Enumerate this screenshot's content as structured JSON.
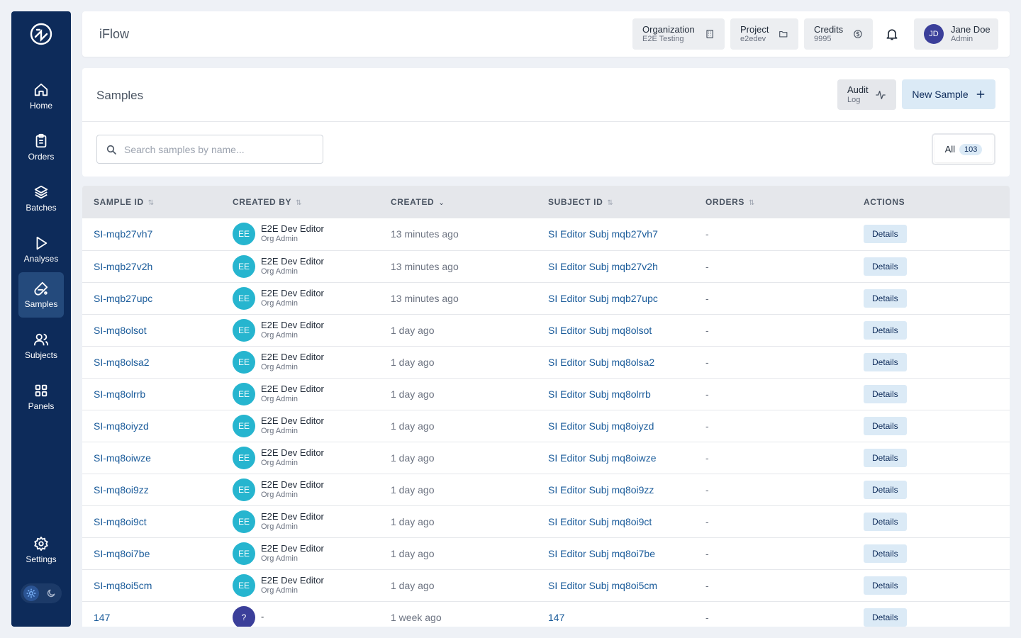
{
  "app": {
    "title": "iFlow"
  },
  "sidebar": {
    "items": [
      {
        "label": "Home",
        "icon": "home-icon"
      },
      {
        "label": "Orders",
        "icon": "clipboard-icon"
      },
      {
        "label": "Batches",
        "icon": "layers-icon"
      },
      {
        "label": "Analyses",
        "icon": "play-icon"
      },
      {
        "label": "Samples",
        "icon": "flask-icon",
        "active": true
      },
      {
        "label": "Subjects",
        "icon": "users-icon"
      },
      {
        "label": "Panels",
        "icon": "grid-icon"
      }
    ],
    "settings": {
      "label": "Settings",
      "icon": "gear-icon"
    },
    "theme": {
      "selected": "light"
    }
  },
  "header": {
    "organization": {
      "title": "Organization",
      "value": "E2E Testing"
    },
    "project": {
      "title": "Project",
      "value": "e2edev"
    },
    "credits": {
      "title": "Credits",
      "value": "9995"
    },
    "user": {
      "initials": "JD",
      "name": "Jane Doe",
      "role": "Admin"
    }
  },
  "samples": {
    "title": "Samples",
    "audit": {
      "title": "Audit",
      "sub": "Log"
    },
    "new_label": "New Sample",
    "search_placeholder": "Search samples by name...",
    "filter": {
      "label": "All",
      "count": "103"
    }
  },
  "table": {
    "columns": [
      "SAMPLE ID",
      "CREATED BY",
      "CREATED",
      "SUBJECT ID",
      "ORDERS",
      "ACTIONS"
    ],
    "action_label": "Details",
    "rows": [
      {
        "id": "SI-mqb27vh7",
        "initials": "EE",
        "creator": "E2E Dev Editor",
        "role": "Org Admin",
        "created": "13 minutes ago",
        "subject": "SI Editor Subj mqb27vh7",
        "orders": "-"
      },
      {
        "id": "SI-mqb27v2h",
        "initials": "EE",
        "creator": "E2E Dev Editor",
        "role": "Org Admin",
        "created": "13 minutes ago",
        "subject": "SI Editor Subj mqb27v2h",
        "orders": "-"
      },
      {
        "id": "SI-mqb27upc",
        "initials": "EE",
        "creator": "E2E Dev Editor",
        "role": "Org Admin",
        "created": "13 minutes ago",
        "subject": "SI Editor Subj mqb27upc",
        "orders": "-"
      },
      {
        "id": "SI-mq8olsot",
        "initials": "EE",
        "creator": "E2E Dev Editor",
        "role": "Org Admin",
        "created": "1 day ago",
        "subject": "SI Editor Subj mq8olsot",
        "orders": "-"
      },
      {
        "id": "SI-mq8olsa2",
        "initials": "EE",
        "creator": "E2E Dev Editor",
        "role": "Org Admin",
        "created": "1 day ago",
        "subject": "SI Editor Subj mq8olsa2",
        "orders": "-"
      },
      {
        "id": "SI-mq8olrrb",
        "initials": "EE",
        "creator": "E2E Dev Editor",
        "role": "Org Admin",
        "created": "1 day ago",
        "subject": "SI Editor Subj mq8olrrb",
        "orders": "-"
      },
      {
        "id": "SI-mq8oiyzd",
        "initials": "EE",
        "creator": "E2E Dev Editor",
        "role": "Org Admin",
        "created": "1 day ago",
        "subject": "SI Editor Subj mq8oiyzd",
        "orders": "-"
      },
      {
        "id": "SI-mq8oiwze",
        "initials": "EE",
        "creator": "E2E Dev Editor",
        "role": "Org Admin",
        "created": "1 day ago",
        "subject": "SI Editor Subj mq8oiwze",
        "orders": "-"
      },
      {
        "id": "SI-mq8oi9zz",
        "initials": "EE",
        "creator": "E2E Dev Editor",
        "role": "Org Admin",
        "created": "1 day ago",
        "subject": "SI Editor Subj mq8oi9zz",
        "orders": "-"
      },
      {
        "id": "SI-mq8oi9ct",
        "initials": "EE",
        "creator": "E2E Dev Editor",
        "role": "Org Admin",
        "created": "1 day ago",
        "subject": "SI Editor Subj mq8oi9ct",
        "orders": "-"
      },
      {
        "id": "SI-mq8oi7be",
        "initials": "EE",
        "creator": "E2E Dev Editor",
        "role": "Org Admin",
        "created": "1 day ago",
        "subject": "SI Editor Subj mq8oi7be",
        "orders": "-"
      },
      {
        "id": "SI-mq8oi5cm",
        "initials": "EE",
        "creator": "E2E Dev Editor",
        "role": "Org Admin",
        "created": "1 day ago",
        "subject": "SI Editor Subj mq8oi5cm",
        "orders": "-"
      },
      {
        "id": "147",
        "initials": "?",
        "creator": "-",
        "role": "",
        "created": "1 week ago",
        "subject": "147",
        "orders": "-"
      }
    ]
  }
}
